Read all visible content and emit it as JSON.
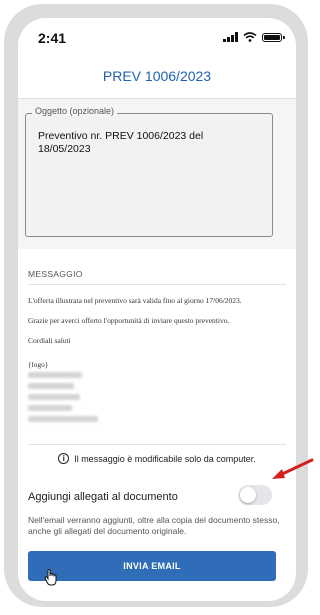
{
  "status_bar": {
    "time": "2:41"
  },
  "header": {
    "title": "PREV 1006/2023"
  },
  "subject": {
    "label": "Oggetto (opzionale)",
    "value_line1": "Preventivo nr. PREV 1006/2023 del",
    "value_line2": "18/05/2023"
  },
  "message": {
    "label": "MESSAGGIO",
    "lines": [
      "L'offerta illustrata nel preventivo sarà valida fino al giorno 17/06/2023.",
      "Grazie per averci offerto l'opportunità di inviare questo preventivo.",
      "Cordiali saluti",
      "{logo}"
    ]
  },
  "notice": {
    "text": "Il messaggio è modificabile solo da computer."
  },
  "attachments": {
    "label": "Aggiungi allegati al documento",
    "toggle_on": false,
    "description": "Nell'email verranno aggiunti, oltre alla copia del documento stesso, anche gli allegati del documento originale."
  },
  "send_button": {
    "label": "INVIA EMAIL"
  },
  "colors": {
    "accent": "#2f6db8",
    "title": "#1f63b3",
    "annotation": "#d62020"
  },
  "icons": [
    "wifi-icon",
    "signal-icon",
    "battery-icon",
    "info-icon",
    "cursor-hand-icon",
    "red-arrow-icon"
  ]
}
